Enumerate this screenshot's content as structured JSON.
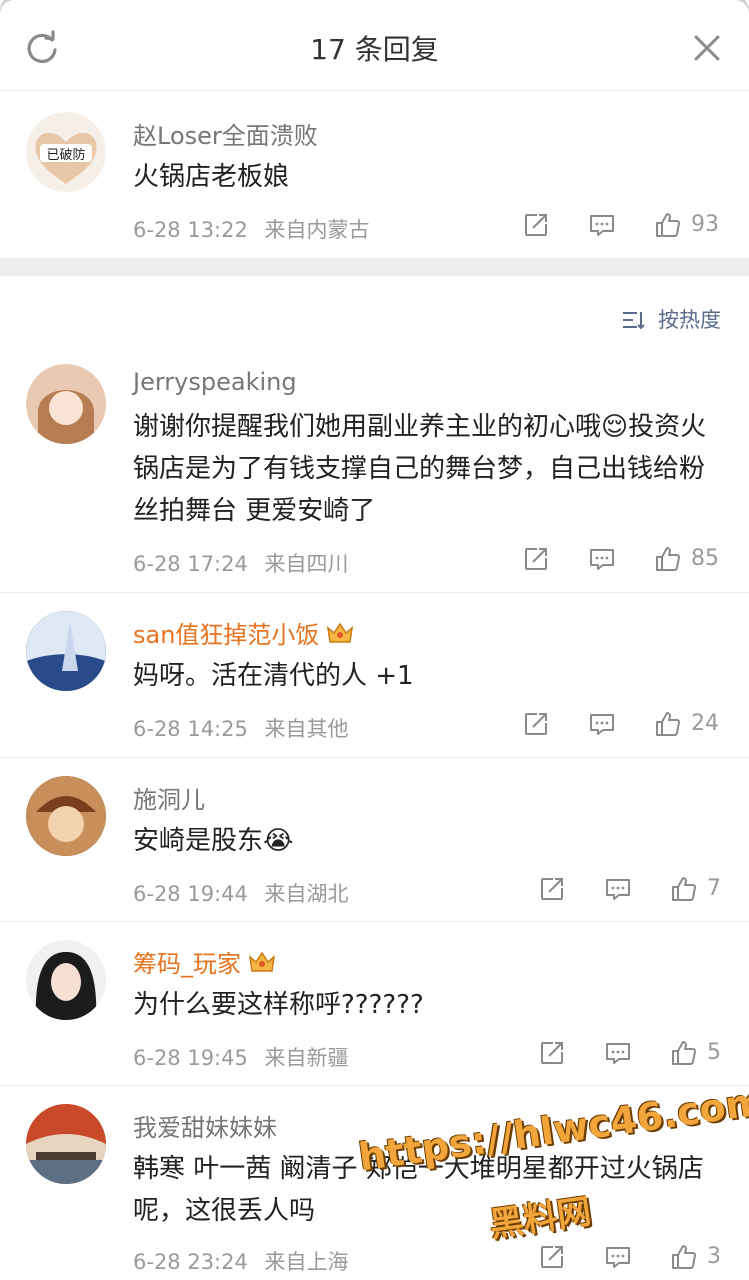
{
  "header": {
    "title": "17 条回复"
  },
  "sort": {
    "label": "按热度"
  },
  "root_comment": {
    "user": "赵Loser全面溃败",
    "avatar_text": "已破防",
    "text": "火锅店老板娘",
    "date": "6-28 13:22",
    "location": "来自内蒙古",
    "likes": "93"
  },
  "replies": [
    {
      "user": "Jerryspeaking",
      "text": "谢谢你提醒我们她用副业养主业的初心哦😌投资火锅店是为了有钱支撑自己的舞台梦，自己出钱给粉丝拍舞台 更爱安崎了",
      "date": "6-28 17:24",
      "location": "来自四川",
      "likes": "85"
    },
    {
      "user": "san值狂掉范小饭",
      "text": "妈呀。活在清代的人 +1",
      "date": "6-28 14:25",
      "location": "来自其他",
      "likes": "24"
    },
    {
      "user": "施洞儿",
      "text": "安崎是股东😭",
      "date": "6-28 19:44",
      "location": "来自湖北",
      "likes": "7"
    },
    {
      "user": "筹码_玩家",
      "text": "为什么要这样称呼??????",
      "date": "6-28 19:45",
      "location": "来自新疆",
      "likes": "5"
    },
    {
      "user": "我爱甜妹妹妹",
      "text": "韩寒 叶一茜 阚清子 郑恺一大堆明星都开过火锅店呢，这很丢人吗",
      "date": "6-28 23:24",
      "location": "来自上海",
      "likes": "3"
    }
  ],
  "watermark": {
    "line1": "https://hlwc46.com",
    "line2": "黑料网"
  },
  "colors": {
    "vip_name": "#e8731e",
    "meta": "#9a9a9a",
    "sort": "#5a6b8c"
  }
}
